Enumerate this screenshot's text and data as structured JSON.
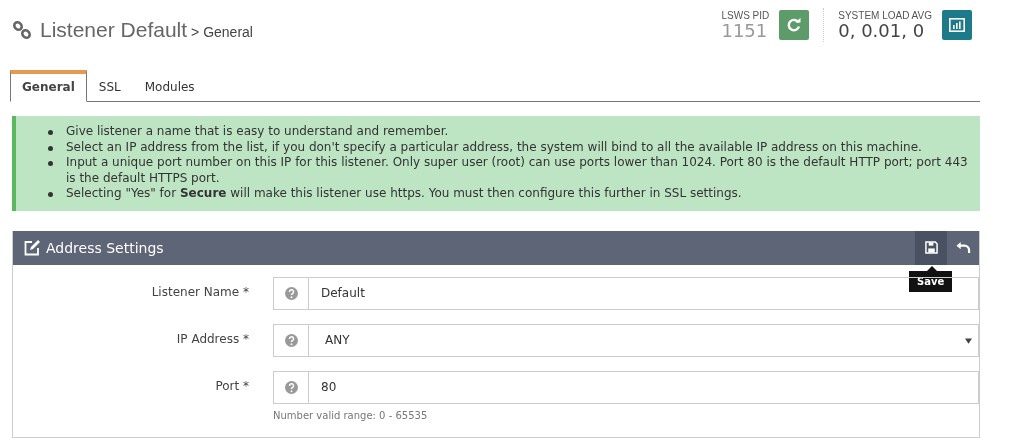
{
  "header": {
    "title": "Listener Default",
    "breadcrumb": "> General",
    "pid_label": "LSWS PID",
    "pid_value": "1151",
    "load_label": "SYSTEM LOAD AVG",
    "load_value": "0, 0.01, 0"
  },
  "tabs": [
    {
      "label": "General",
      "selected": true
    },
    {
      "label": "SSL",
      "selected": false
    },
    {
      "label": "Modules",
      "selected": false
    }
  ],
  "tips": [
    "Give listener a name that is easy to understand and remember.",
    "Select an IP address from the list, if you don't specify a particular address, the system will bind to all the available IP address on this machine.",
    "Input a unique port number on this IP for this listener. Only super user (root) can use ports lower than 1024. Port 80 is the default HTTP port; port 443 is the default HTTPS port.",
    "Selecting \"Yes\" for **Secure** will make this listener use https. You must then configure this further in SSL settings."
  ],
  "panel": {
    "title": "Address Settings",
    "tooltip": "Save",
    "fields": [
      {
        "label": "Listener Name *",
        "kind": "text",
        "value": "Default"
      },
      {
        "label": "IP Address *",
        "kind": "select",
        "value": "ANY"
      },
      {
        "label": "Port *",
        "kind": "text",
        "value": "80",
        "hint": "Number valid range: 0 - 65535"
      }
    ]
  }
}
